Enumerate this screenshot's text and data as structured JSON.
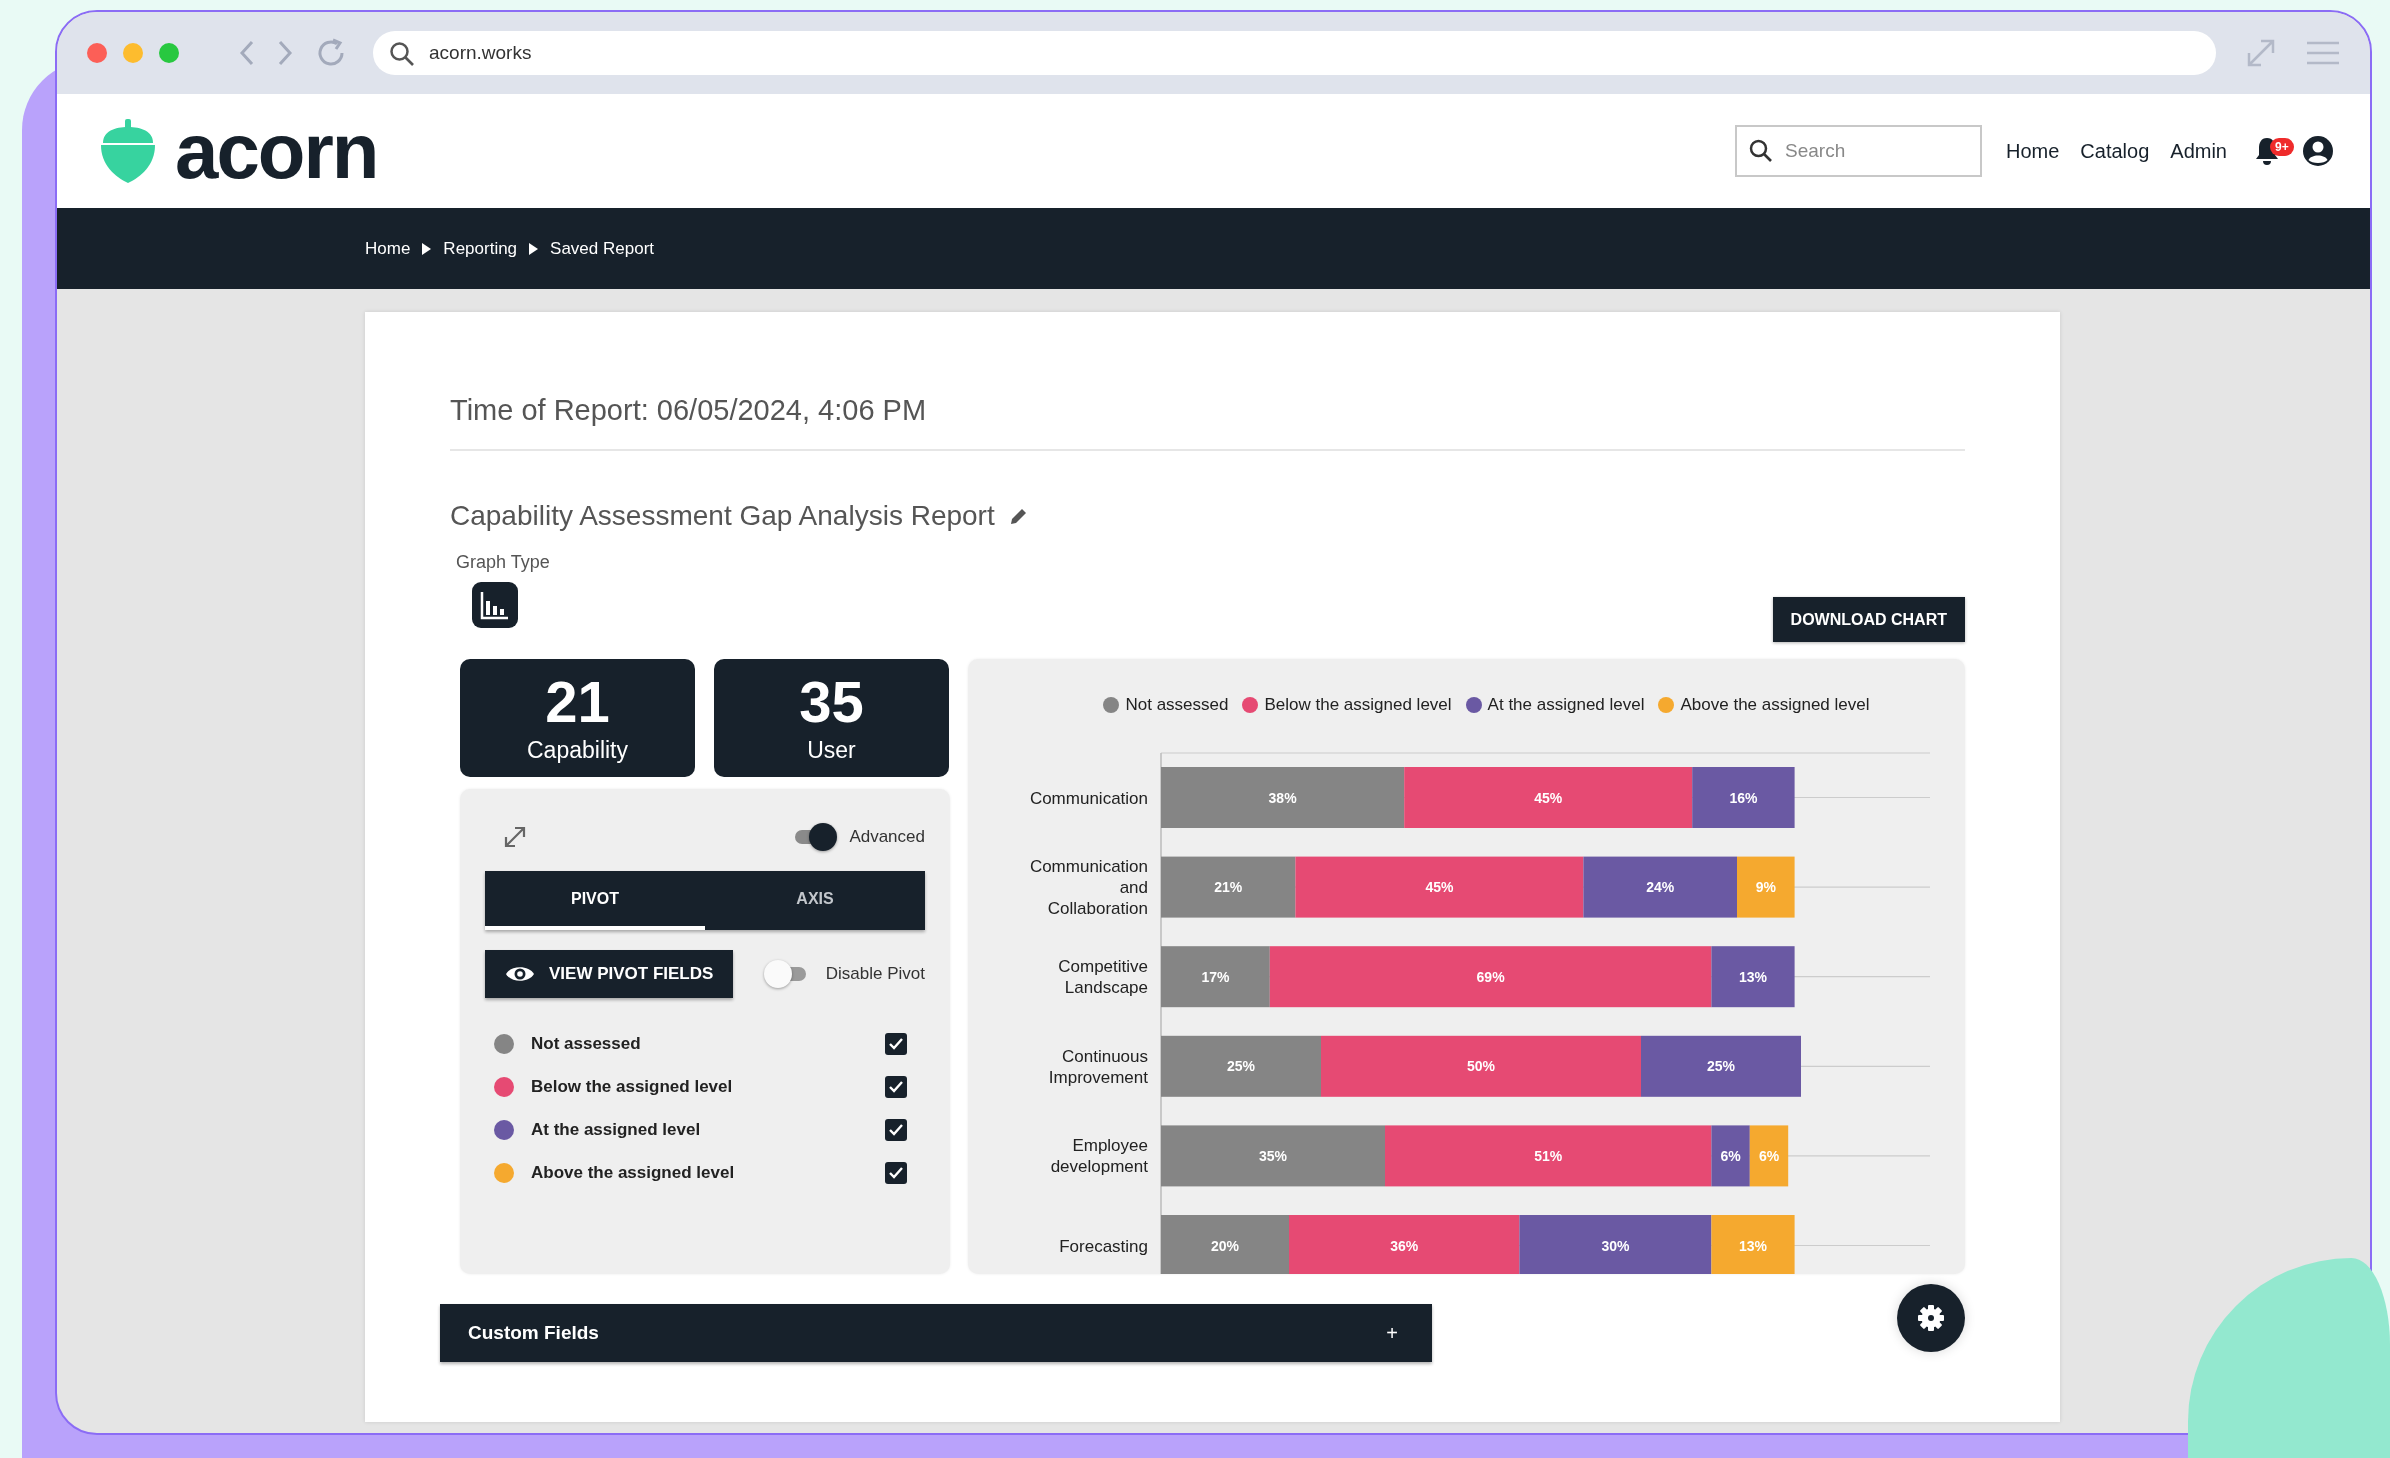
{
  "browser": {
    "address": "acorn.works"
  },
  "header": {
    "logo": "acorn",
    "search": {
      "placeholder": "Search"
    },
    "nav": [
      "Home",
      "Catalog",
      "Admin"
    ],
    "notification_badge": "9+"
  },
  "breadcrumb": [
    {
      "label": "Home"
    },
    {
      "label": "Reporting"
    },
    {
      "label": "Saved Report"
    }
  ],
  "report": {
    "time": "Time of Report: 06/05/2024, 4:06 PM",
    "title": "Capability Assessment Gap Analysis Report",
    "graph_type_label": "Graph Type",
    "download_button": "DOWNLOAD CHART"
  },
  "stats": [
    {
      "value": "21",
      "label": "Capability"
    },
    {
      "value": "35",
      "label": "User"
    }
  ],
  "panel": {
    "advanced": {
      "label": "Advanced",
      "on": true
    },
    "tabs": [
      {
        "label": "PIVOT",
        "selected": true
      },
      {
        "label": "AXIS",
        "selected": false
      }
    ],
    "view_button": "VIEW PIVOT FIELDS",
    "disable_pivot": {
      "label": "Disable Pivot",
      "on": false
    },
    "series": [
      {
        "label": "Not assessed",
        "color": "#858585",
        "checked": true
      },
      {
        "label": "Below the assigned level",
        "color": "#e64a73",
        "checked": true
      },
      {
        "label": "At the assigned level",
        "color": "#6a59a3",
        "checked": true
      },
      {
        "label": "Above the assigned level",
        "color": "#f5a92f",
        "checked": true
      }
    ]
  },
  "chart": {
    "chart_data": {
      "type": "bar",
      "orientation": "horizontal",
      "stacked": true,
      "legend": "top",
      "categories": [
        "Communication",
        "Communication and Collaboration",
        "Competitive Landscape",
        "Continuous Improvement",
        "Employee development",
        "Forecasting"
      ],
      "series": [
        {
          "name": "Not assessed",
          "color": "#858585",
          "values": [
            38,
            21,
            17,
            25,
            35,
            20
          ],
          "value_labels": [
            "38%",
            "21%",
            "17%",
            "25%",
            "35%",
            "20%"
          ]
        },
        {
          "name": "Below the assigned level",
          "color": "#e64a73",
          "values": [
            45,
            45,
            69,
            50,
            51,
            36
          ],
          "value_labels": [
            "45%",
            "45%",
            "69%",
            "50%",
            "51%",
            "36%"
          ]
        },
        {
          "name": "At the assigned level",
          "color": "#6a59a3",
          "values": [
            16,
            24,
            13,
            25,
            6,
            30
          ],
          "value_labels": [
            "16%",
            "24%",
            "13%",
            "25%",
            "6%",
            "30%"
          ]
        },
        {
          "name": "Above the assigned level",
          "color": "#f5a92f",
          "values": [
            null,
            9,
            null,
            null,
            6,
            13
          ],
          "value_labels": [
            null,
            "9%",
            null,
            null,
            "6%",
            "13%"
          ]
        }
      ]
    }
  },
  "custom_fields": {
    "label": "Custom Fields",
    "expand": "+"
  }
}
